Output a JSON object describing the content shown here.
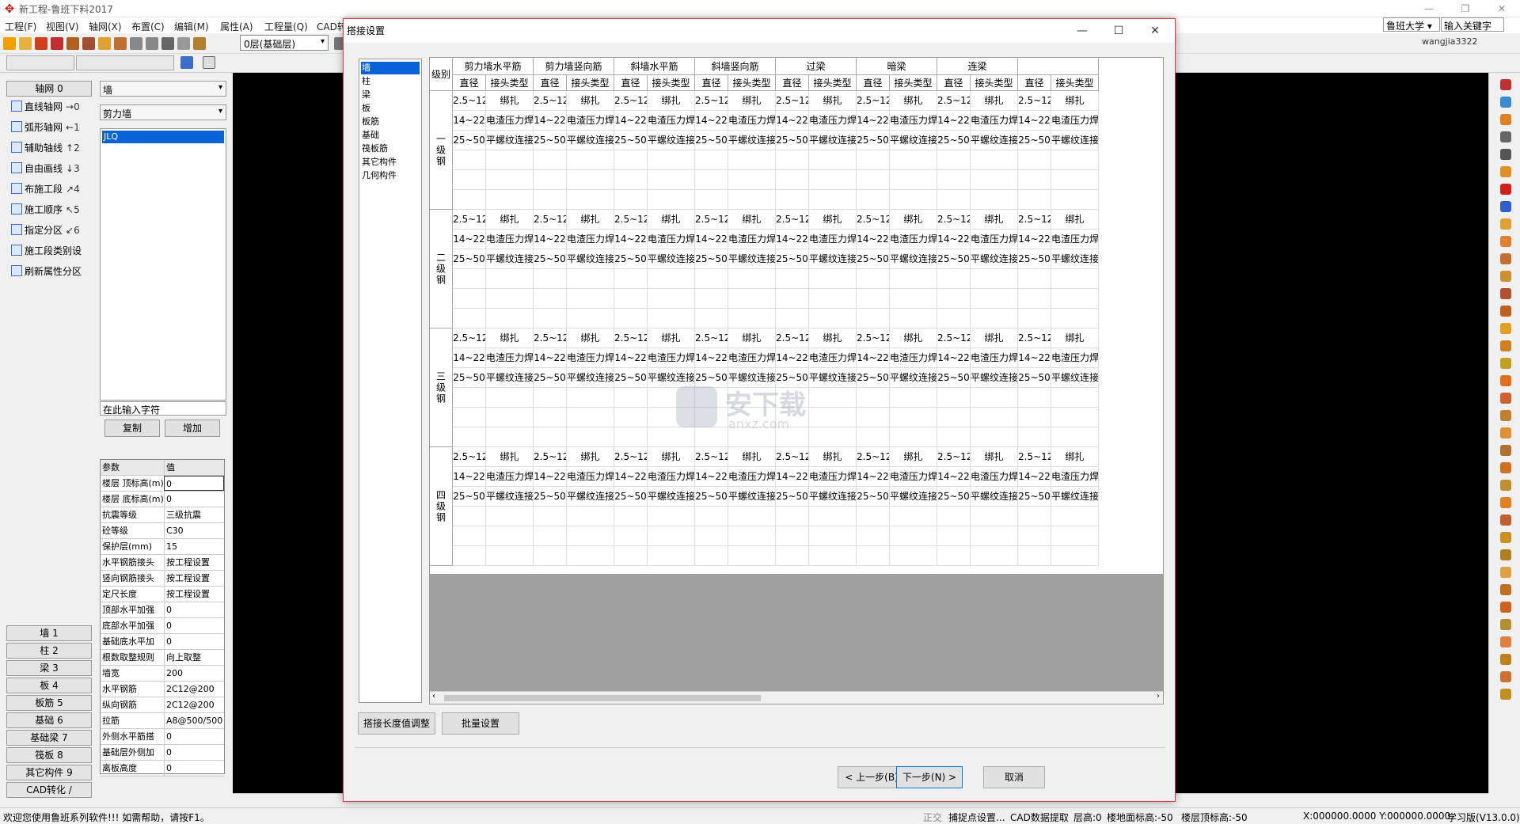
{
  "app": {
    "title": "新工程-鲁班下料2017",
    "menus": [
      "工程(F)",
      "视图(V)",
      "轴网(X)",
      "布置(C)",
      "编辑(M)",
      "属性(A)",
      "工程量(Q)",
      "CAD转"
    ],
    "layer_select": "0层(基础层)",
    "top_combo1": "鲁班大学",
    "top_combo2": "输入关键字",
    "user": "wangjia3322"
  },
  "leftnav": {
    "header": "轴网 0",
    "items": [
      {
        "label": "直线轴网",
        "key": "→0"
      },
      {
        "label": "弧形轴网",
        "key": "←1"
      },
      {
        "label": "辅助轴线",
        "key": "↑2"
      },
      {
        "label": "自由画线",
        "key": "↓3"
      },
      {
        "label": "布施工段",
        "key": "↗4"
      },
      {
        "label": "施工顺序",
        "key": "↖5"
      },
      {
        "label": "指定分区",
        "key": "↙6"
      },
      {
        "label": "施工段类别设",
        "key": ""
      },
      {
        "label": "刷新属性分区",
        "key": ""
      }
    ],
    "groups": [
      "墙 1",
      "柱 2",
      "梁 3",
      "板 4",
      "板筋 5",
      "基础 6",
      "基础梁 7",
      "筏板 8",
      "其它构件 9",
      "CAD转化 /"
    ]
  },
  "leftpanel": {
    "select1": "墙",
    "select2": "剪力墙",
    "list_item": "JLQ",
    "search_placeholder": "在此输入字符",
    "copy_btn": "复制",
    "add_btn": "增加",
    "prop_header_key": "参数",
    "prop_header_val": "值",
    "props": [
      {
        "k": "楼层 顶标高(m)",
        "v": "0"
      },
      {
        "k": "楼层 底标高(m)",
        "v": "0"
      },
      {
        "k": "抗震等级",
        "v": "三级抗震"
      },
      {
        "k": "砼等级",
        "v": "C30"
      },
      {
        "k": "保护层(mm)",
        "v": "15"
      },
      {
        "k": "水平钢筋接头",
        "v": "按工程设置"
      },
      {
        "k": "竖向钢筋接头",
        "v": "按工程设置"
      },
      {
        "k": "定尺长度",
        "v": "按工程设置"
      },
      {
        "k": "顶部水平加强",
        "v": "0"
      },
      {
        "k": "底部水平加强",
        "v": "0"
      },
      {
        "k": "基础底水平加",
        "v": "0"
      },
      {
        "k": "根数取整规则",
        "v": "向上取整"
      },
      {
        "k": "墙宽",
        "v": "200"
      },
      {
        "k": "水平钢筋",
        "v": "2C12@200"
      },
      {
        "k": "纵向钢筋",
        "v": "2C12@200"
      },
      {
        "k": "拉筋",
        "v": "A8@500/500"
      },
      {
        "k": "外侧水平筋搭",
        "v": "0"
      },
      {
        "k": "基础层外侧加",
        "v": "0"
      },
      {
        "k": "离板高度",
        "v": "0"
      }
    ]
  },
  "dialog": {
    "title": "搭接设置",
    "categories": [
      "墙",
      "柱",
      "梁",
      "板",
      "板筋",
      "基础",
      "筏板筋",
      "其它构件",
      "几何构件"
    ],
    "grade_header": "级别",
    "groups": [
      "剪力墙水平筋",
      "剪力墙竖向筋",
      "斜墙水平筋",
      "斜墙竖向筋",
      "过梁",
      "暗梁",
      "连梁"
    ],
    "sub_headers": [
      "直径",
      "接头类型"
    ],
    "grades": [
      "一级钢",
      "二级钢",
      "三级钢",
      "四级钢"
    ],
    "rows": [
      {
        "d": "2.5~12",
        "t": "绑扎"
      },
      {
        "d": "14~22",
        "t": "电渣压力焊"
      },
      {
        "d": "25~50",
        "t": "平螺纹连接"
      }
    ],
    "buttons": {
      "length_adjust": "搭接长度值调整",
      "batch": "批量设置",
      "prev": "< 上一步(B)",
      "next": "下一步(N) >",
      "cancel": "取消"
    }
  },
  "status": {
    "welcome": "欢迎您使用鲁班系列软件!!!  如需帮助，请按F1。",
    "ortho": "正交",
    "snap": "捕捉点设置...",
    "cad": "CAD数据提取",
    "floor": "层高:0",
    "ground": "楼地面标高:-50",
    "top": "楼层顶标高:-50",
    "coords": "X:000000.0000  Y:000000.0000",
    "version": "学习版(V13.0.0)"
  },
  "watermark": {
    "text1": "安下载",
    "text2": "anxz.com"
  }
}
